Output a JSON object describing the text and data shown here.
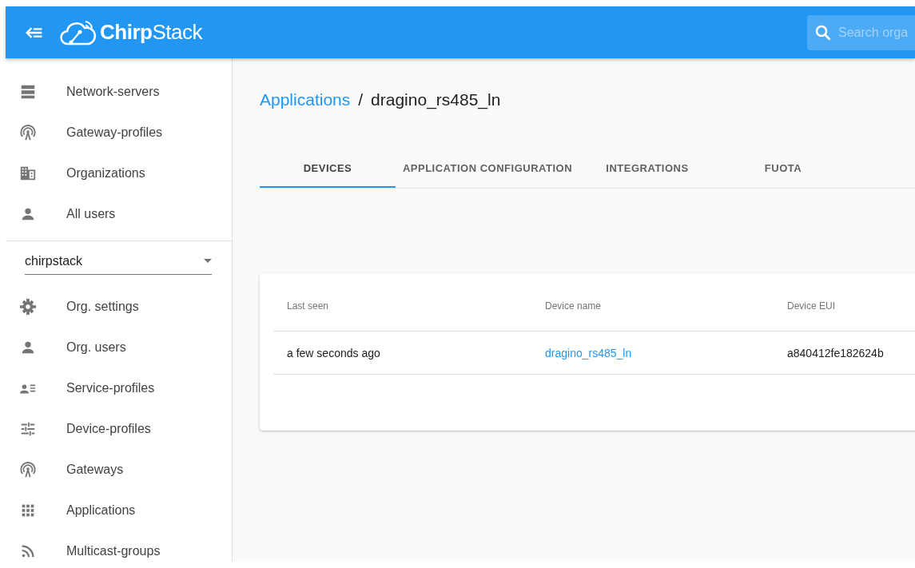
{
  "header": {
    "logo": "**Chirp**Stack",
    "search": {
      "placeholder": "Search orga"
    }
  },
  "sidebar": {
    "items": [
      {
        "label": "Network-servers",
        "selected": false
      },
      {
        "label": "Gateway-profiles",
        "selected": false
      },
      {
        "label": "Organizations",
        "selected": false
      },
      {
        "label": "All users",
        "selected": false
      }
    ],
    "organization": {
      "value": "chirpstack"
    },
    "org_items": [
      {
        "label": "Org. settings",
        "selected": false
      },
      {
        "label": "Org. users",
        "selected": false
      },
      {
        "label": "Service-profiles",
        "selected": false
      },
      {
        "label": "Device-profiles",
        "selected": false
      },
      {
        "label": "Gateways",
        "selected": false
      },
      {
        "label": "Applications",
        "selected": false
      },
      {
        "label": "Multicast-groups",
        "selected": false
      }
    ]
  },
  "breadcrumb": {
    "link": "Applications",
    "separator": "/",
    "current": "dragino_rs485_ln"
  },
  "tabs": [
    {
      "label": "DEVICES",
      "selected": true
    },
    {
      "label": "APPLICATION CONFIGURATION",
      "selected": false
    },
    {
      "label": "INTEGRATIONS",
      "selected": false
    },
    {
      "label": "FUOTA",
      "selected": false
    }
  ],
  "table": {
    "columns": [
      "Last seen",
      "Device name",
      "Device EUI"
    ],
    "rows": [
      {
        "last_seen": "a few seconds ago",
        "device_name": "dragino_rs485_ln",
        "device_eui": "a840412fe182624b"
      }
    ]
  }
}
